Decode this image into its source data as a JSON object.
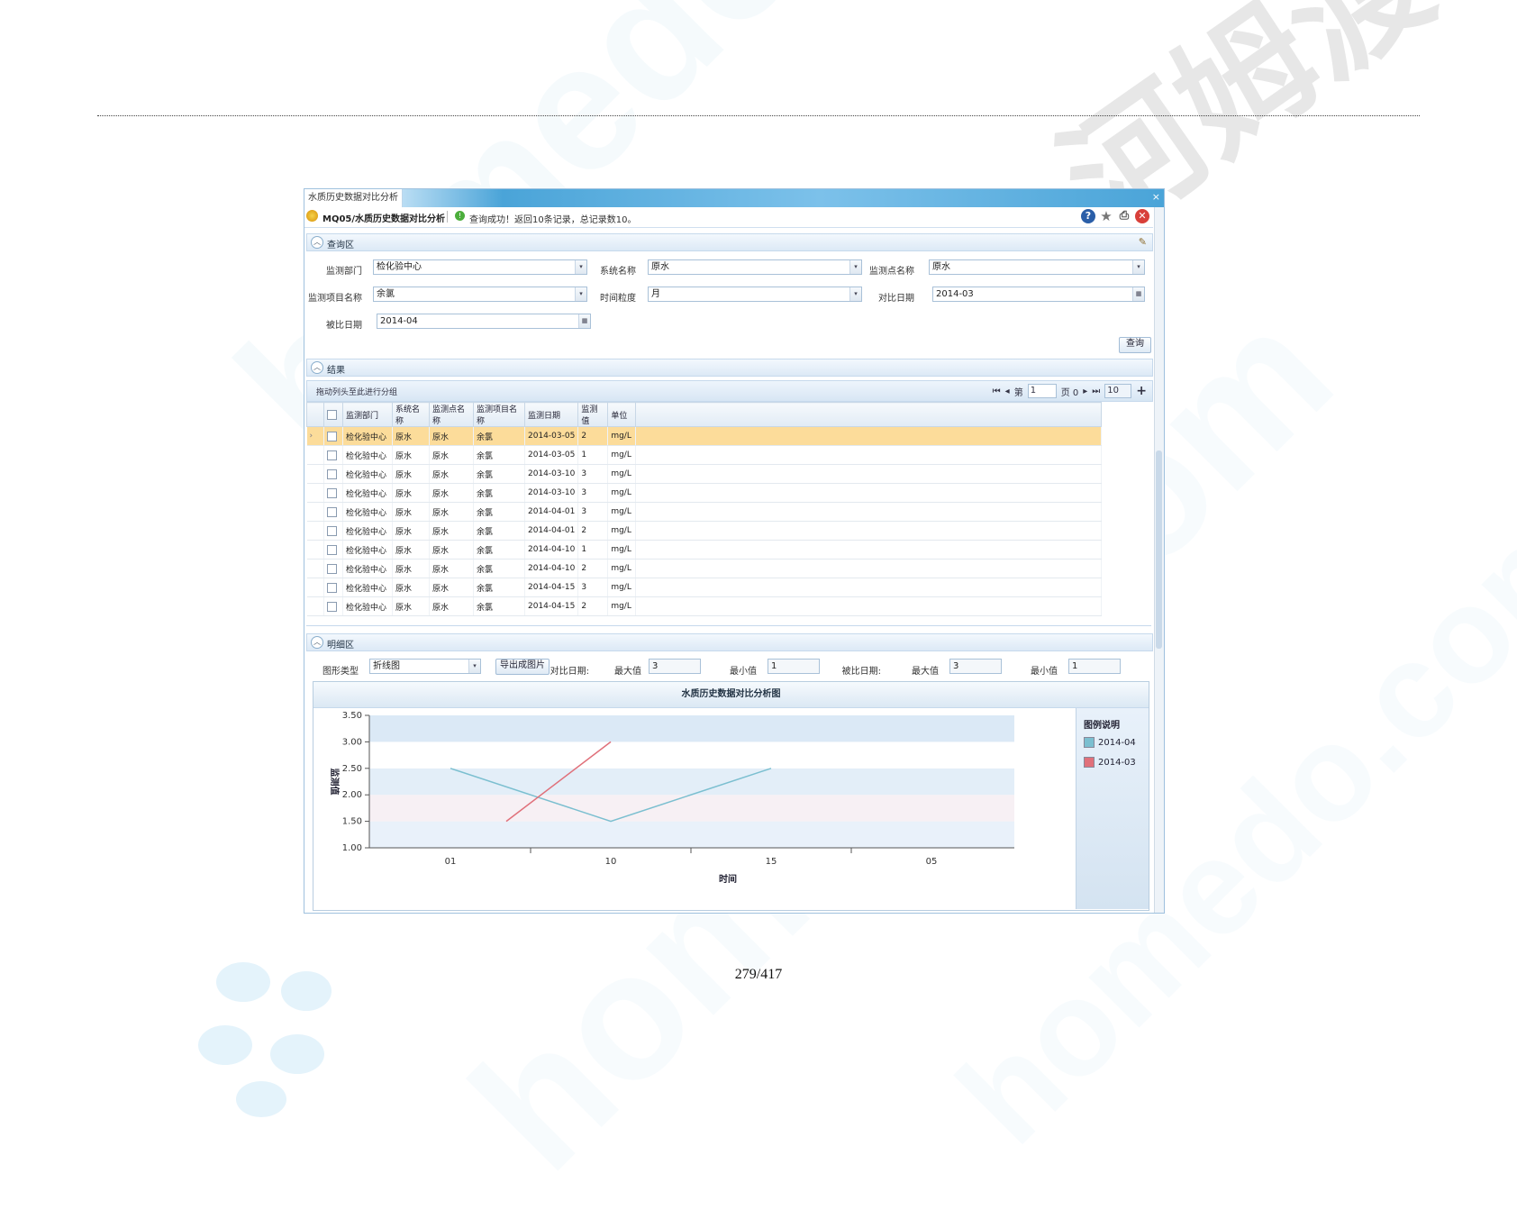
{
  "watermark": {
    "text_a": "homedo.com",
    "text_b": "河姆渡"
  },
  "footer": {
    "page": "279/417"
  },
  "window": {
    "tab_title": "水质历史数据对比分析",
    "close": "×"
  },
  "toolbar": {
    "path": "MQ05/水质历史数据对比分析",
    "status": "查询成功！返回10条记录，总记录数10。",
    "icons": [
      "help-icon",
      "star-icon",
      "print-icon",
      "close-icon"
    ]
  },
  "query_section": {
    "title": "查询区",
    "fields": {
      "dept": {
        "label": "监测部门",
        "value": "检化验中心"
      },
      "system": {
        "label": "系统名称",
        "value": "原水"
      },
      "point": {
        "label": "监测点名称",
        "value": "原水"
      },
      "item": {
        "label": "监测项目名称",
        "value": "余氯"
      },
      "granularity": {
        "label": "时间粒度",
        "value": "月"
      },
      "compare_date": {
        "label": "对比日期",
        "value": "2014-03"
      },
      "compared_date": {
        "label": "被比日期",
        "value": "2014-04"
      }
    },
    "query_button": "查询"
  },
  "result_section": {
    "title": "结果",
    "group_hint": "拖动列头至此进行分组",
    "pager": {
      "page_label": "第",
      "page": "1",
      "of_label": "页 0",
      "page_size": "10"
    },
    "columns": [
      "监测部门",
      "系统名称",
      "监测点名称",
      "监测项目名称",
      "监测日期",
      "监测值",
      "单位"
    ],
    "rows": [
      [
        "检化验中心",
        "原水",
        "原水",
        "余氯",
        "2014-03-05",
        "2",
        "mg/L"
      ],
      [
        "检化验中心",
        "原水",
        "原水",
        "余氯",
        "2014-03-05",
        "1",
        "mg/L"
      ],
      [
        "检化验中心",
        "原水",
        "原水",
        "余氯",
        "2014-03-10",
        "3",
        "mg/L"
      ],
      [
        "检化验中心",
        "原水",
        "原水",
        "余氯",
        "2014-03-10",
        "3",
        "mg/L"
      ],
      [
        "检化验中心",
        "原水",
        "原水",
        "余氯",
        "2014-04-01",
        "3",
        "mg/L"
      ],
      [
        "检化验中心",
        "原水",
        "原水",
        "余氯",
        "2014-04-01",
        "2",
        "mg/L"
      ],
      [
        "检化验中心",
        "原水",
        "原水",
        "余氯",
        "2014-04-10",
        "1",
        "mg/L"
      ],
      [
        "检化验中心",
        "原水",
        "原水",
        "余氯",
        "2014-04-10",
        "2",
        "mg/L"
      ],
      [
        "检化验中心",
        "原水",
        "原水",
        "余氯",
        "2014-04-15",
        "3",
        "mg/L"
      ],
      [
        "检化验中心",
        "原水",
        "原水",
        "余氯",
        "2014-04-15",
        "2",
        "mg/L"
      ]
    ]
  },
  "detail_section": {
    "title": "明细区",
    "chart_type_label": "图形类型",
    "chart_type_value": "折线图",
    "export_button": "导出成图片",
    "compare_date_label": "对比日期:",
    "compare_max_label": "最大值",
    "compare_max": "3",
    "compare_min_label": "最小值",
    "compare_min": "1",
    "compared_date_label": "被比日期:",
    "compared_max_label": "最大值",
    "compared_max": "3",
    "compared_min_label": "最小值",
    "compared_min": "1"
  },
  "chart_data": {
    "type": "line",
    "title": "水质历史数据对比分析图",
    "xlabel": "时间",
    "ylabel": "监测值",
    "x_ticks": [
      "01",
      "10",
      "15",
      "05"
    ],
    "y_ticks": [
      "1.00",
      "1.50",
      "2.00",
      "2.50",
      "3.00",
      "3.50"
    ],
    "ylim": [
      1.0,
      3.5
    ],
    "grid_bands": true,
    "legend_title": "图例说明",
    "legend_position": "right",
    "series": [
      {
        "name": "2014-04",
        "color": "#7bbfd0",
        "x": [
          "01",
          "10",
          "15"
        ],
        "y": [
          2.5,
          1.5,
          2.5
        ]
      },
      {
        "name": "2014-03",
        "color": "#e0707a",
        "x": [
          "05",
          "10"
        ],
        "y": [
          1.5,
          3.0
        ]
      }
    ]
  },
  "colors": {
    "accent": "#4aa4d8",
    "selected_row": "#fcdc9a"
  }
}
